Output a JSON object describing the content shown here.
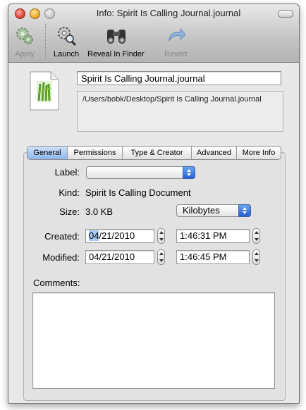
{
  "window": {
    "title": "Info: Spirit Is Calling Journal.journal"
  },
  "toolbar": {
    "apply": "Apply",
    "launch": "Launch",
    "reveal": "Reveal In Finder",
    "revert": "Revert"
  },
  "file": {
    "name": "Spirit Is Calling Journal.journal",
    "path": "/Users/bobk/Desktop/Spirit Is Calling Journal.journal"
  },
  "tabs": [
    {
      "label": "General",
      "active": true
    },
    {
      "label": "Permissions",
      "active": false
    },
    {
      "label": "Type & Creator",
      "active": false
    },
    {
      "label": "Advanced",
      "active": false
    },
    {
      "label": "More Info",
      "active": false
    }
  ],
  "general": {
    "label_label": "Label:",
    "label_value": "",
    "kind_label": "Kind:",
    "kind_value": "Spirit Is Calling Document",
    "size_label": "Size:",
    "size_value": "3.0 KB",
    "size_unit": "Kilobytes",
    "created_label": "Created:",
    "created_month": "04",
    "created_rest": "/21/2010",
    "created_time": "1:46:31 PM",
    "modified_label": "Modified:",
    "modified_date": "04/21/2010",
    "modified_time": "1:46:45 PM",
    "comments_label": "Comments:",
    "comments_value": ""
  },
  "colors": {
    "selection": "#a9c9f5",
    "popup_arrows": "#2660d2"
  }
}
